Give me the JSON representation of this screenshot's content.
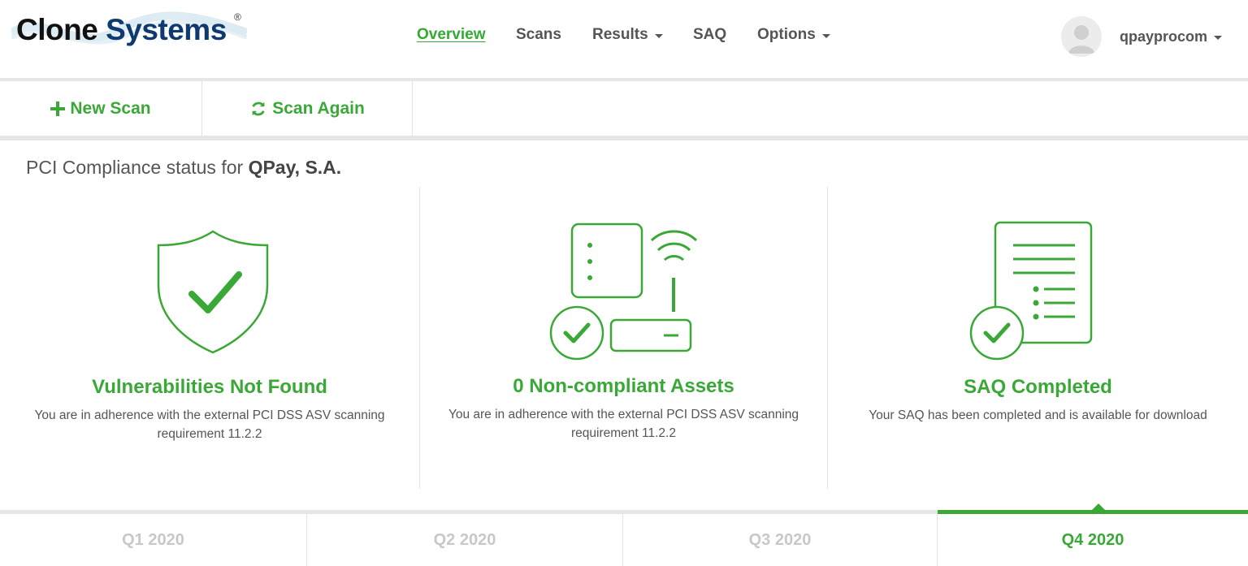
{
  "brand": {
    "name_part1": "Clone",
    "name_part2": "Systems",
    "reg": "®"
  },
  "nav": {
    "items": [
      {
        "label": "Overview",
        "active": true
      },
      {
        "label": "Scans"
      },
      {
        "label": "Results"
      },
      {
        "label": "SAQ"
      },
      {
        "label": "Options"
      }
    ]
  },
  "user": {
    "name": "qpayprocom",
    "icon": "user-avatar-icon"
  },
  "toolbar": {
    "new_scan_label": "New Scan",
    "scan_again_label": "Scan Again"
  },
  "page": {
    "title_prefix": "PCI Compliance status for",
    "company": "QPay, S.A."
  },
  "cards": [
    {
      "icon": "shield-check-icon",
      "title": "Vulnerabilities Not Found",
      "desc": "You are in adherence with the external PCI DSS ASV scanning requirement 11.2.2"
    },
    {
      "icon": "server-router-check-icon",
      "title": "0 Non-compliant Assets",
      "desc": "You are in adherence with the external PCI DSS ASV scanning requirement 11.2.2"
    },
    {
      "icon": "document-check-icon",
      "title": "SAQ Completed",
      "desc": "Your SAQ has been completed and is available for download"
    }
  ],
  "quarters": [
    {
      "label": "Q1 2020"
    },
    {
      "label": "Q2 2020"
    },
    {
      "label": "Q3 2020"
    },
    {
      "label": "Q4 2020",
      "active": true
    }
  ],
  "colors": {
    "accent": "#3aa836",
    "text": "#555555",
    "divider": "#e6e6e6"
  }
}
